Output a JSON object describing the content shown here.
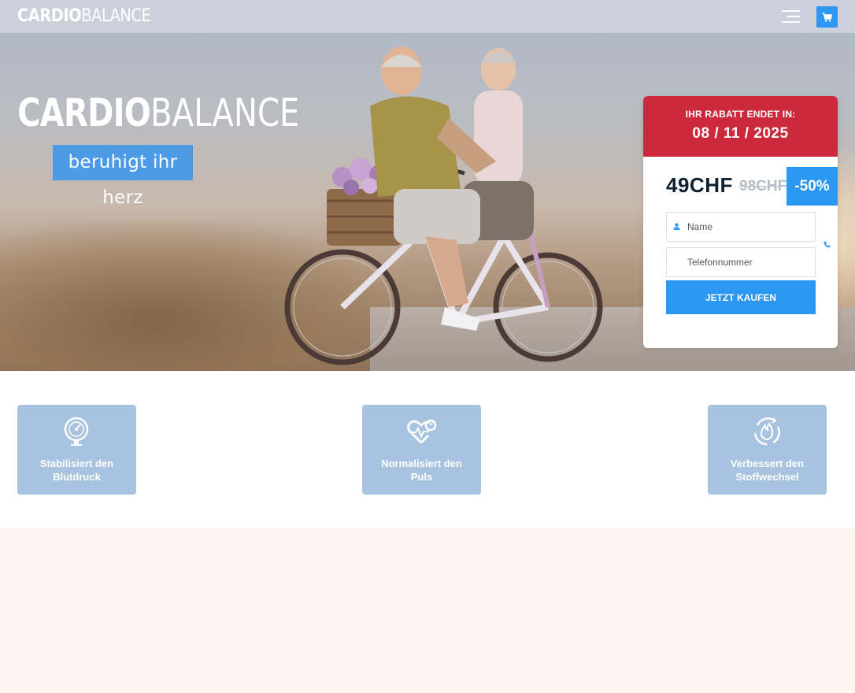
{
  "header": {
    "brand_bold": "CARDIO",
    "brand_light": "BALANCE",
    "menu_icon": "hamburger-menu-icon",
    "cart_icon": "shopping-cart-icon"
  },
  "hero": {
    "logo_bold": "CARDIO",
    "logo_light": "BALANCE",
    "tagline": "beruhigt ihr herz"
  },
  "offer": {
    "countdown_label": "IHR RABATT ENDET IN:",
    "countdown_date": "08 / 11 / 2025",
    "price_new": "49CHF",
    "price_old": "98CHF",
    "discount": "-50%",
    "name_placeholder": "Name",
    "phone_placeholder": "Telefonnummer",
    "buy_label": "JETZT KAUFEN",
    "colors": {
      "header": "#cc2a3c",
      "accent": "#2c97f2"
    }
  },
  "features": [
    {
      "icon": "blood-pressure-gauge-icon",
      "line1": "Stabilisiert den",
      "line2": "Blutdruck"
    },
    {
      "icon": "heart-pulse-icon",
      "line1": "Normalisiert den",
      "line2": "Puls"
    },
    {
      "icon": "metabolism-flame-icon",
      "line1": "Verbessert den",
      "line2": "Stoffwechsel"
    }
  ]
}
